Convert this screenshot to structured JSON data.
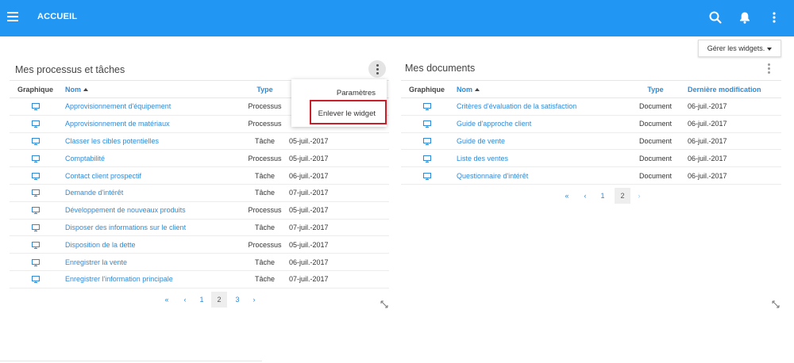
{
  "appbar": {
    "title": "ACCUEIL",
    "icons": [
      "menu-icon",
      "search-icon",
      "bell-icon",
      "more-vert-icon"
    ],
    "color": "#2196f3"
  },
  "manage_widgets": {
    "label": "Gérer les widgets."
  },
  "process_widget": {
    "title": "Mes processus et tâches",
    "columns": {
      "graphic": "Graphique",
      "name": "Nom",
      "type": "Type"
    },
    "rows": [
      {
        "name": "Approvisionnement d'équipement",
        "type": "Processus",
        "date": ""
      },
      {
        "name": "Approvisionnement de matériaux",
        "type": "Processus",
        "date": ""
      },
      {
        "name": "Classer les cibles potentielles",
        "type": "Tâche",
        "date": "05-juil.-2017"
      },
      {
        "name": "Comptabilité",
        "type": "Processus",
        "date": "05-juil.-2017"
      },
      {
        "name": "Contact client prospectif",
        "type": "Tâche",
        "date": "06-juil.-2017"
      },
      {
        "name": "Demande d'intérêt",
        "type": "Tâche",
        "date": "07-juil.-2017"
      },
      {
        "name": "Développement de nouveaux produits",
        "type": "Processus",
        "date": "05-juil.-2017"
      },
      {
        "name": "Disposer des informations sur le client",
        "type": "Tâche",
        "date": "07-juil.-2017"
      },
      {
        "name": "Disposition de la dette",
        "type": "Processus",
        "date": "05-juil.-2017"
      },
      {
        "name": "Enregistrer la vente",
        "type": "Tâche",
        "date": "06-juil.-2017"
      },
      {
        "name": "Enregistrer l'information principale",
        "type": "Tâche",
        "date": "07-juil.-2017"
      }
    ],
    "pagination": {
      "first": "«",
      "prev": "‹",
      "pages": [
        "1",
        "2",
        "3"
      ],
      "active": "2",
      "next": "›"
    },
    "menu": {
      "settings": "Paramètres",
      "remove": "Enlever le widget"
    }
  },
  "documents_widget": {
    "title": "Mes documents",
    "columns": {
      "graphic": "Graphique",
      "name": "Nom",
      "type": "Type",
      "modified": "Dernière modification"
    },
    "rows": [
      {
        "name": "Critères d'évaluation de la satisfaction",
        "type": "Document",
        "date": "06-juil.-2017"
      },
      {
        "name": "Guide d'approche client",
        "type": "Document",
        "date": "06-juil.-2017"
      },
      {
        "name": "Guide de vente",
        "type": "Document",
        "date": "06-juil.-2017"
      },
      {
        "name": "Liste des ventes",
        "type": "Document",
        "date": "06-juil.-2017"
      },
      {
        "name": "Questionnaire d'intérêt",
        "type": "Document",
        "date": "06-juil.-2017"
      }
    ],
    "pagination": {
      "first": "«",
      "prev": "‹",
      "pages": [
        "1",
        "2"
      ],
      "active": "2",
      "next": "›"
    }
  },
  "colors": {
    "link": "#2e8ad8",
    "highlight": "#c81f2b"
  }
}
